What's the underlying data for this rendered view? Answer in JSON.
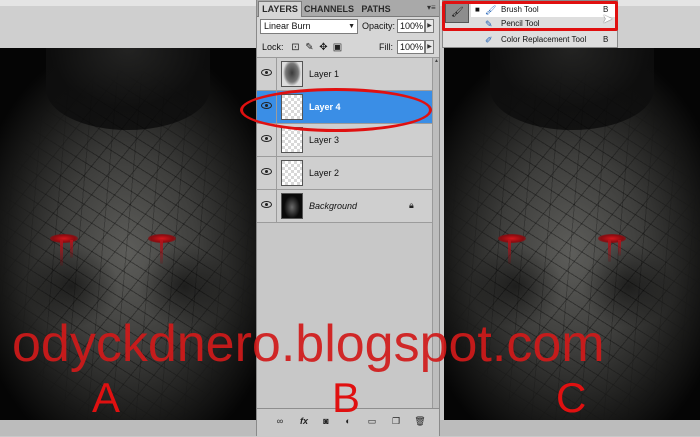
{
  "colors": {
    "accent_red": "#e01010",
    "selection_blue": "#3a8ee6",
    "watermark_red": "#d11a1a"
  },
  "panel": {
    "tabs": [
      {
        "label": "LAYERS",
        "active": true
      },
      {
        "label": "CHANNELS",
        "active": false
      },
      {
        "label": "PATHS",
        "active": false
      }
    ],
    "blend_mode": "Linear Burn",
    "opacity_label": "Opacity:",
    "opacity_value": "100%",
    "lock_label": "Lock:",
    "fill_label": "Fill:",
    "fill_value": "100%",
    "layers": [
      {
        "name": "Layer 1",
        "thumb": "hand",
        "visible": true,
        "selected": false
      },
      {
        "name": "Layer 4",
        "thumb": "transparent",
        "visible": true,
        "selected": true
      },
      {
        "name": "Layer 3",
        "thumb": "transparent",
        "visible": true,
        "selected": false
      },
      {
        "name": "Layer 2",
        "thumb": "transparent",
        "visible": true,
        "selected": false
      },
      {
        "name": "Background",
        "thumb": "face",
        "visible": true,
        "selected": false,
        "locked": true
      }
    ],
    "footer_icons": [
      "link-icon",
      "fx-icon",
      "mask-icon",
      "adjustment-icon",
      "group-folder-icon",
      "new-layer-icon",
      "trash-icon"
    ]
  },
  "flyout": {
    "items": [
      {
        "name": "Brush Tool",
        "shortcut": "B",
        "active": true,
        "icon": "brush-icon"
      },
      {
        "name": "Pencil Tool",
        "shortcut": "",
        "active": false,
        "icon": "pencil-icon"
      },
      {
        "name": "Color Replacement Tool",
        "shortcut": "B",
        "active": false,
        "icon": "color-replacement-icon"
      }
    ]
  },
  "watermark": "odyckdnero.blogspot.com",
  "labels": {
    "a": "A",
    "b": "B",
    "c": "C"
  }
}
